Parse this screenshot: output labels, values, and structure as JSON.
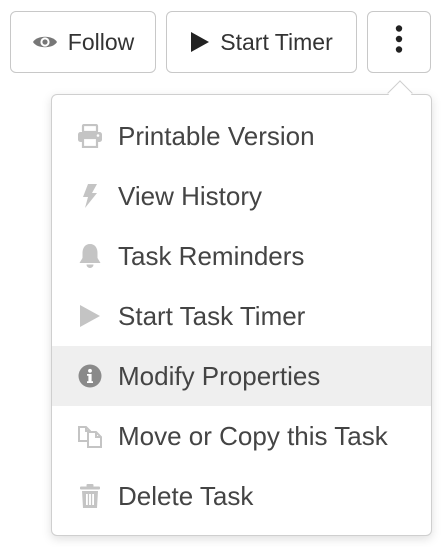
{
  "toolbar": {
    "follow_label": "Follow",
    "follow_icon": "eye-icon",
    "start_timer_label": "Start Timer",
    "start_timer_icon": "play-icon",
    "more_icon": "vertical-ellipsis-icon"
  },
  "menu": {
    "items": [
      {
        "label": "Printable Version",
        "icon": "printer-icon"
      },
      {
        "label": "View History",
        "icon": "lightning-icon"
      },
      {
        "label": "Task Reminders",
        "icon": "bell-icon"
      },
      {
        "label": "Start Task Timer",
        "icon": "play-icon"
      },
      {
        "label": "Modify Properties",
        "icon": "info-circle-icon",
        "highlighted": true
      },
      {
        "label": "Move or Copy this Task",
        "icon": "copy-icon"
      },
      {
        "label": "Delete Task",
        "icon": "trash-icon"
      }
    ]
  },
  "colors": {
    "text": "#333333",
    "menu_icon": "#c4c4c4",
    "info_icon": "#8a8a8a",
    "hover_background": "#efefef",
    "border": "#c8c8c8"
  }
}
